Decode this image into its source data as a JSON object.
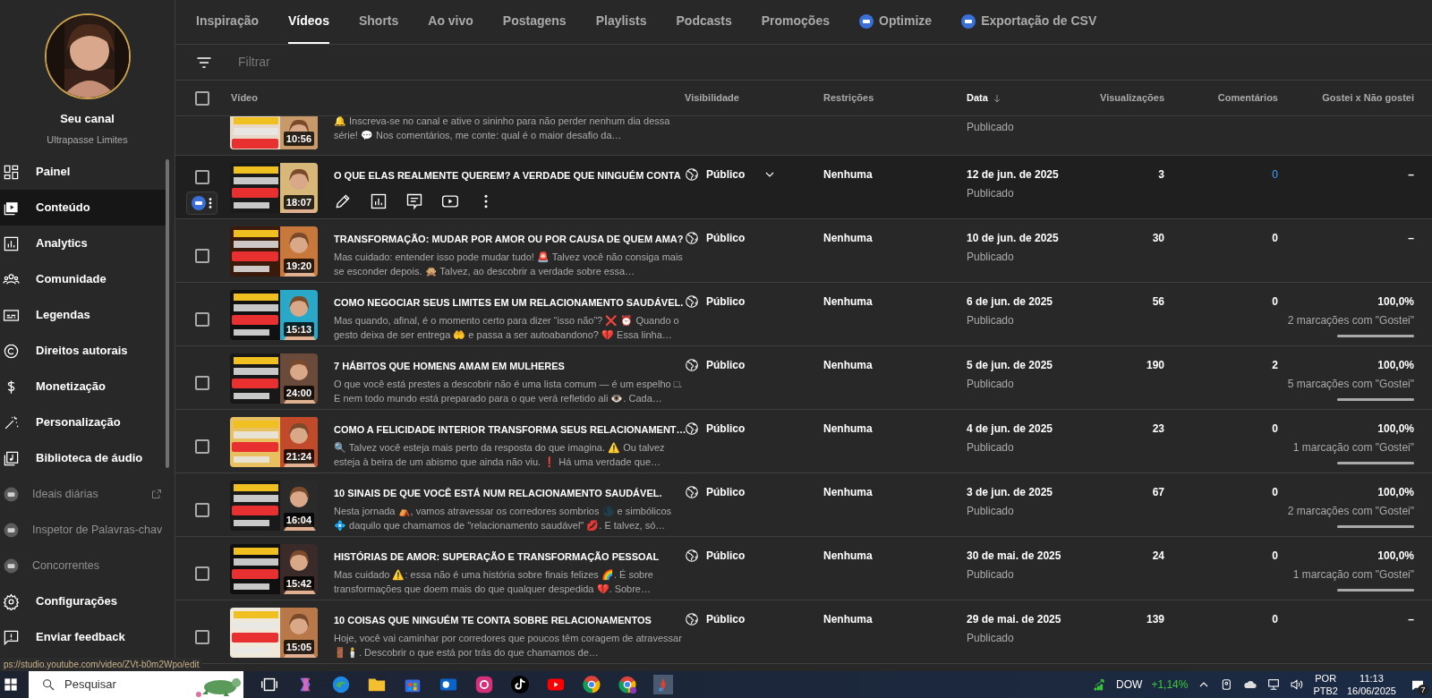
{
  "sidebar": {
    "channel_label": "Seu canal",
    "channel_name": "Ultrapasse Limites",
    "items": [
      {
        "label": "Painel",
        "kind": "nav",
        "selected": false
      },
      {
        "label": "Conteúdo",
        "kind": "nav",
        "selected": true
      },
      {
        "label": "Analytics",
        "kind": "nav",
        "selected": false
      },
      {
        "label": "Comunidade",
        "kind": "nav",
        "selected": false
      },
      {
        "label": "Legendas",
        "kind": "nav",
        "selected": false
      },
      {
        "label": "Direitos autorais",
        "kind": "nav",
        "selected": false
      },
      {
        "label": "Monetização",
        "kind": "nav",
        "selected": false
      },
      {
        "label": "Personalização",
        "kind": "nav",
        "selected": false
      },
      {
        "label": "Biblioteca de áudio",
        "kind": "nav",
        "selected": false
      },
      {
        "label": "Ideais diárias",
        "kind": "extension_link",
        "selected": false
      },
      {
        "label": "Inspetor de Palavras-chav",
        "kind": "extension",
        "selected": false
      },
      {
        "label": "Concorrentes",
        "kind": "extension",
        "selected": false
      }
    ],
    "footer_items": [
      {
        "label": "Configurações"
      },
      {
        "label": "Enviar feedback"
      }
    ]
  },
  "tabs": [
    {
      "label": "Inspiração",
      "selected": false,
      "kind": "plain"
    },
    {
      "label": "Vídeos",
      "selected": true,
      "kind": "plain"
    },
    {
      "label": "Shorts",
      "selected": false,
      "kind": "plain"
    },
    {
      "label": "Ao vivo",
      "selected": false,
      "kind": "plain"
    },
    {
      "label": "Postagens",
      "selected": false,
      "kind": "plain"
    },
    {
      "label": "Playlists",
      "selected": false,
      "kind": "plain"
    },
    {
      "label": "Podcasts",
      "selected": false,
      "kind": "plain"
    },
    {
      "label": "Promoções",
      "selected": false,
      "kind": "plain"
    },
    {
      "label": "Optimize",
      "selected": false,
      "kind": "extension"
    },
    {
      "label": "Exportação de CSV",
      "selected": false,
      "kind": "extension"
    }
  ],
  "filter": {
    "placeholder": "Filtrar"
  },
  "table": {
    "select_all_checked": false,
    "columns": [
      {
        "label": "Vídeo",
        "sorted": false
      },
      {
        "label": "Visibilidade",
        "sorted": false
      },
      {
        "label": "Restrições",
        "sorted": false
      },
      {
        "label": "Data",
        "sorted": true
      },
      {
        "label": "Visualizações",
        "sorted": false
      },
      {
        "label": "Comentários",
        "sorted": false
      },
      {
        "label": "Gostei x Não gostei",
        "sorted": false
      }
    ],
    "rows": [
      {
        "partial": true,
        "hovered": false,
        "duration": "10:56",
        "description": "🔔 Inscreva-se no canal e ative o sininho para não perder nenhum dia dessa série! 💬 Nos comentários, me conte: qual é o maior desafio da…",
        "status": "Publicado"
      },
      {
        "partial": false,
        "hovered": true,
        "checked": false,
        "duration": "18:07",
        "title": "O QUE ELAS REALMENTE QUEREM? A VERDADE QUE NINGUÉM CONTA",
        "visibility": "Público",
        "restrictions": "Nenhuma",
        "date": "12 de jun. de 2025",
        "status": "Publicado",
        "views": "3",
        "comments": "0",
        "likes": "–"
      },
      {
        "partial": false,
        "hovered": false,
        "checked": false,
        "duration": "19:20",
        "title": "TRANSFORMAÇÃO: MUDAR POR AMOR OU POR CAUSA DE QUEM AMA?",
        "description": "Mas cuidado: entender isso pode mudar tudo! 🚨 Talvez você não consiga mais se esconder depois. 🙊 Talvez, ao descobrir a verdade sobre essa…",
        "visibility": "Público",
        "restrictions": "Nenhuma",
        "date": "10 de jun. de 2025",
        "status": "Publicado",
        "views": "30",
        "comments": "0",
        "likes": "–"
      },
      {
        "partial": false,
        "hovered": false,
        "checked": false,
        "duration": "15:13",
        "title": "COMO NEGOCIAR SEUS LIMITES EM UM RELACIONAMENTO SAUDÁVEL.",
        "description": "Mas quando, afinal, é o momento certo para dizer “isso não”? ❌ ⏰ Quando o gesto deixa de ser entrega 🤲 e passa a ser autoabandono? 💔 Essa linha…",
        "visibility": "Público",
        "restrictions": "Nenhuma",
        "date": "6 de jun. de 2025",
        "status": "Publicado",
        "views": "56",
        "comments": "0",
        "likes": "100,0%",
        "likes_count": "2 marcações com \"Gostei\"",
        "level": 1
      },
      {
        "partial": false,
        "hovered": false,
        "checked": false,
        "duration": "24:00",
        "title": "7 HÁBITOS QUE HOMENS AMAM EM MULHERES",
        "description": "O que você está prestes a descobrir não é uma lista comum — é um espelho □. E nem todo mundo está preparado para o que verá refletido ali 👁️. Cada…",
        "visibility": "Público",
        "restrictions": "Nenhuma",
        "date": "5 de jun. de 2025",
        "status": "Publicado",
        "views": "190",
        "comments": "2",
        "likes": "100,0%",
        "likes_count": "5 marcações com \"Gostei\"",
        "level": 1
      },
      {
        "partial": false,
        "hovered": false,
        "checked": false,
        "duration": "21:24",
        "title": "COMO A FELICIDADE INTERIOR TRANSFORMA SEUS RELACIONAMENT…",
        "description": "🔍 Talvez você esteja mais perto da resposta do que imagina. ⚠️ Ou talvez esteja à beira de um abismo que ainda não viu. ❗ Há uma verdade que…",
        "visibility": "Público",
        "restrictions": "Nenhuma",
        "date": "4 de jun. de 2025",
        "status": "Publicado",
        "views": "23",
        "comments": "0",
        "likes": "100,0%",
        "likes_count": "1 marcação com \"Gostei\"",
        "level": 1
      },
      {
        "partial": false,
        "hovered": false,
        "checked": false,
        "duration": "16:04",
        "title": "10 SINAIS DE QUE VOCÊ ESTÁ NUM RELACIONAMENTO SAUDÁVEL.",
        "description": "Nesta jornada ⛺, vamos atravessar os corredores sombrios 🌑 e simbólicos 💠 daquilo que chamamos de \"relacionamento saudável\" 💋. E talvez, só…",
        "visibility": "Público",
        "restrictions": "Nenhuma",
        "date": "3 de jun. de 2025",
        "status": "Publicado",
        "views": "67",
        "comments": "0",
        "likes": "100,0%",
        "likes_count": "2 marcações com \"Gostei\"",
        "level": 1
      },
      {
        "partial": false,
        "hovered": false,
        "checked": false,
        "duration": "15:42",
        "title": "HISTÓRIAS DE AMOR: SUPERAÇÃO E TRANSFORMAÇÃO PESSOAL",
        "description": "Mas cuidado ⚠️: essa não é uma história sobre finais felizes 🌈. É sobre transformações que doem mais do que qualquer despedida 💔. Sobre…",
        "visibility": "Público",
        "restrictions": "Nenhuma",
        "date": "30 de mai. de 2025",
        "status": "Publicado",
        "views": "24",
        "comments": "0",
        "likes": "100,0%",
        "likes_count": "1 marcação com \"Gostei\"",
        "level": 1
      },
      {
        "partial": false,
        "hovered": false,
        "checked": false,
        "duration": "15:05",
        "title": "10 COISAS QUE NINGUÉM TE CONTA SOBRE RELACIONAMENTOS",
        "description": "Hoje, você vai caminhar por corredores que poucos têm coragem de atravessar 🚪🕯️. Descobrir o que está por trás do que chamamos de…",
        "visibility": "Público",
        "restrictions": "Nenhuma",
        "date": "29 de mai. de 2025",
        "status": "Publicado",
        "views": "139",
        "comments": "0",
        "likes": "–"
      }
    ]
  },
  "status_url": "ps://studio.youtube.com/video/ZVt-b0m2Wpo/edit",
  "taskbar": {
    "search_placeholder": "Pesquisar",
    "ticker": "DOW",
    "ticker_change": "+1,14%",
    "lang_1": "POR",
    "lang_2": "PTB2",
    "time": "11:13",
    "date": "16/06/2025",
    "notifications": "7"
  }
}
